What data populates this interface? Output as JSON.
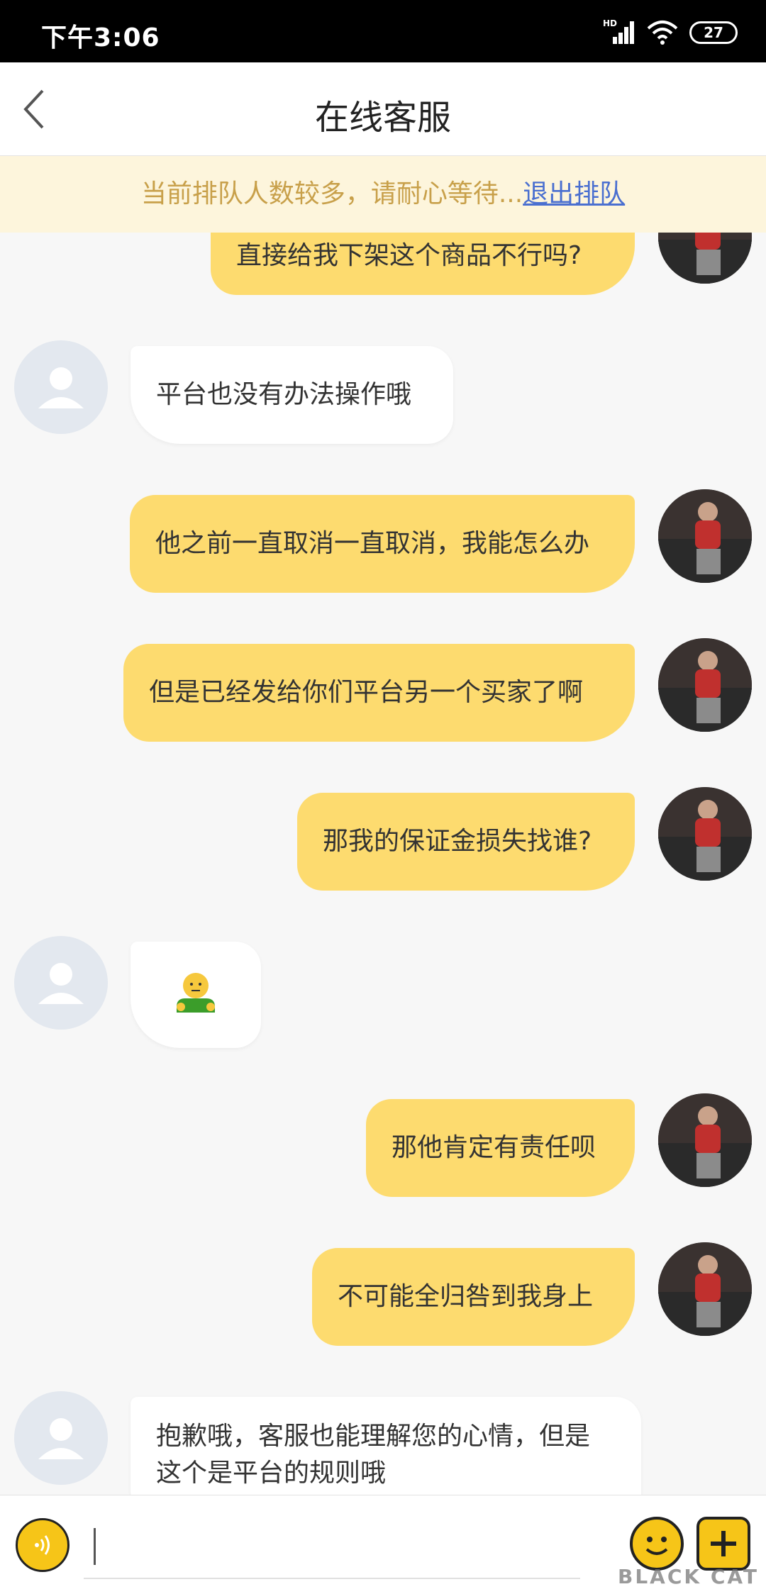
{
  "status_bar": {
    "time": "下午3:06",
    "network_label": "HD",
    "battery": "27"
  },
  "header": {
    "title": "在线客服"
  },
  "queue_banner": {
    "text": "当前排队人数较多，请耐心等待...",
    "exit_link": "退出排队"
  },
  "messages": [
    {
      "sender": "user",
      "text": "直接给我下架这个商品不行吗?"
    },
    {
      "sender": "agent",
      "text": "平台也没有办法操作哦"
    },
    {
      "sender": "user",
      "text": "他之前一直取消一直取消，我能怎么办"
    },
    {
      "sender": "user",
      "text": "但是已经发给你们平台另一个买家了啊"
    },
    {
      "sender": "user",
      "text": "那我的保证金损失找谁?"
    },
    {
      "sender": "agent",
      "text": "",
      "emoji": "shrug-emoji"
    },
    {
      "sender": "user",
      "text": "那他肯定有责任呗"
    },
    {
      "sender": "user",
      "text": "不可能全归咎到我身上"
    },
    {
      "sender": "agent",
      "text": "抱歉哦，客服也能理解您的心情，但是",
      "text2": "这个是平台的规则哦"
    }
  ],
  "input_bar": {
    "placeholder": ""
  },
  "watermark": "BLACK CAT",
  "colors": {
    "user_bubble": "#fddb6f",
    "agent_bubble": "#ffffff",
    "banner_bg": "#fdf5dc",
    "banner_text": "#c8a04a",
    "link": "#4a6fd0"
  }
}
